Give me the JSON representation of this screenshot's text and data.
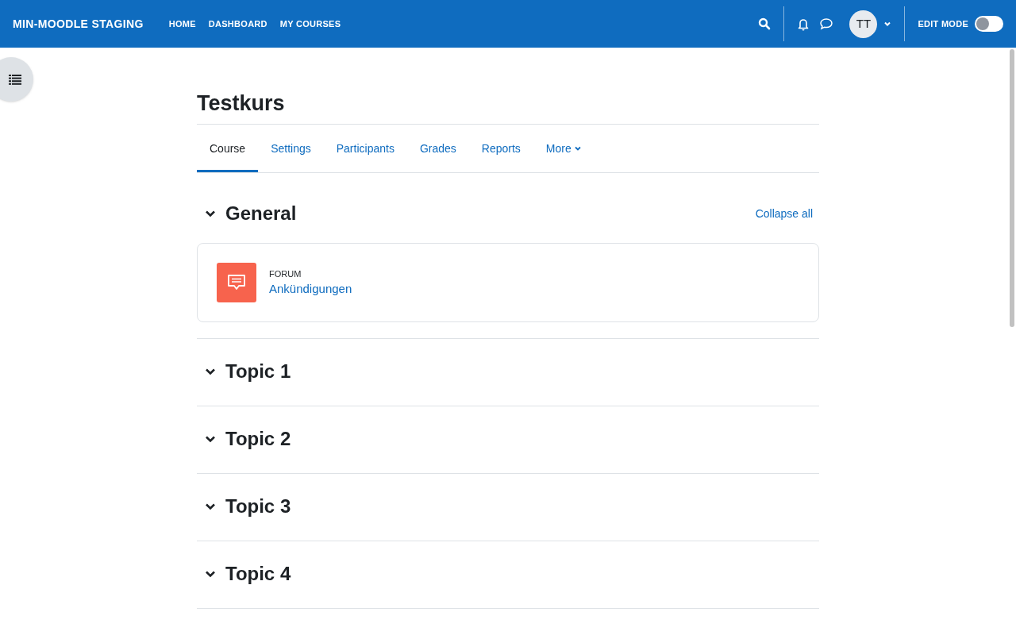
{
  "navbar": {
    "site_name": "MIN-MOODLE STAGING",
    "links": [
      "HOME",
      "DASHBOARD",
      "MY COURSES"
    ],
    "avatar_initials": "TT",
    "edit_mode": {
      "label": "EDIT MODE",
      "on": false
    }
  },
  "course": {
    "title": "Testkurs"
  },
  "tabs": [
    {
      "label": "Course",
      "selected": true,
      "kind": "link"
    },
    {
      "label": "Settings",
      "selected": false,
      "kind": "link"
    },
    {
      "label": "Participants",
      "selected": false,
      "kind": "link"
    },
    {
      "label": "Grades",
      "selected": false,
      "kind": "link"
    },
    {
      "label": "Reports",
      "selected": false,
      "kind": "link"
    },
    {
      "label": "More",
      "selected": false,
      "kind": "menu"
    }
  ],
  "collapse_all": "Collapse all",
  "sections": [
    {
      "title": "General",
      "expanded": true,
      "activities": [
        {
          "type": "FORUM",
          "name": "Ankündigungen"
        }
      ]
    },
    {
      "title": "Topic 1",
      "expanded": true
    },
    {
      "title": "Topic 2",
      "expanded": true
    },
    {
      "title": "Topic 3",
      "expanded": true
    },
    {
      "title": "Topic 4",
      "expanded": true
    }
  ]
}
